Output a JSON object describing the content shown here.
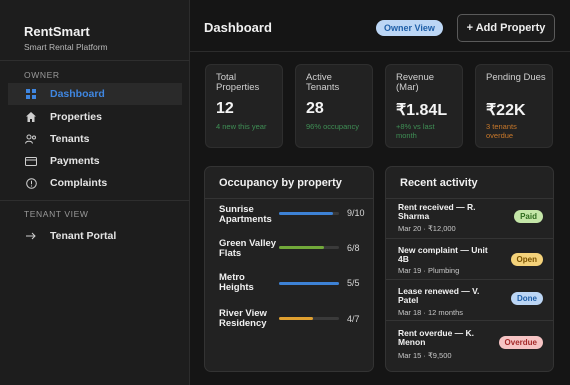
{
  "brand": {
    "name": "RentSmart",
    "tagline": "Smart Rental Platform"
  },
  "sidebar": {
    "owner_label": "OWNER",
    "owner_items": [
      {
        "label": "Dashboard",
        "icon": "grid-icon"
      },
      {
        "label": "Properties",
        "icon": "home-icon"
      },
      {
        "label": "Tenants",
        "icon": "people-icon"
      },
      {
        "label": "Payments",
        "icon": "card-icon"
      },
      {
        "label": "Complaints",
        "icon": "alert-circle-icon"
      }
    ],
    "tenant_label": "TENANT VIEW",
    "tenant_items": [
      {
        "label": "Tenant Portal",
        "icon": "arrow-right-icon"
      }
    ]
  },
  "header": {
    "title": "Dashboard",
    "view_badge": "Owner View",
    "add_button": "+ Add Property"
  },
  "stats": [
    {
      "label": "Total Properties",
      "value": "12",
      "note": "4 new this year",
      "note_color": "#3f8f55"
    },
    {
      "label": "Active Tenants",
      "value": "28",
      "note": "96% occupancy",
      "note_color": "#3f8f55"
    },
    {
      "label": "Revenue (Mar)",
      "value": "₹1.84L",
      "note": "+8% vs last month",
      "note_color": "#3f8f55"
    },
    {
      "label": "Pending Dues",
      "value": "₹22K",
      "note": "3 tenants overdue",
      "note_color": "#c8782a"
    }
  ],
  "occupancy": {
    "title": "Occupancy by property",
    "rows": [
      {
        "name": "Sunrise Apartments",
        "value": "9/10",
        "fraction": 0.9,
        "color": "#3d82d6"
      },
      {
        "name": "Green Valley Flats",
        "value": "6/8",
        "fraction": 0.75,
        "color": "#72a93a"
      },
      {
        "name": "Metro Heights",
        "value": "5/5",
        "fraction": 1.0,
        "color": "#3d82d6"
      },
      {
        "name": "River View Residency",
        "value": "4/7",
        "fraction": 0.57,
        "color": "#e0a030"
      }
    ]
  },
  "activity": {
    "title": "Recent activity",
    "items": [
      {
        "title": "Rent received — R. Sharma",
        "meta": "Mar 20 · ₹12,000",
        "status": "Paid",
        "bg": "#c4e6a8",
        "fg": "#2f6b1e"
      },
      {
        "title": "New complaint — Unit 4B",
        "meta": "Mar 19 · Plumbing",
        "status": "Open",
        "bg": "#f4d27a",
        "fg": "#7a5200"
      },
      {
        "title": "Lease renewed — V. Patel",
        "meta": "Mar 18 · 12 months",
        "status": "Done",
        "bg": "#bcd6f5",
        "fg": "#1f5fa8"
      },
      {
        "title": "Rent overdue — K. Menon",
        "meta": "Mar 15 · ₹9,500",
        "status": "Overdue",
        "bg": "#f6c4c4",
        "fg": "#a42a2a"
      }
    ]
  }
}
